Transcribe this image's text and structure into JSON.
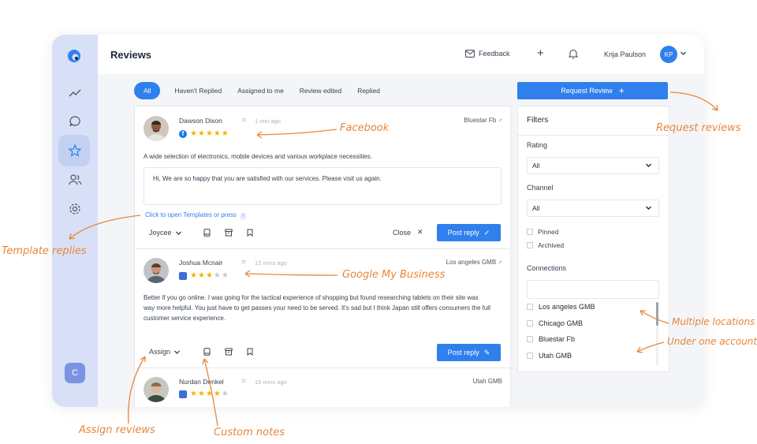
{
  "header": {
    "title": "Reviews",
    "feedback_label": "Feedback",
    "user_name": "Krija Paulson",
    "user_initials": "KP"
  },
  "sidebar": {
    "user_initial": "C",
    "items": [
      "analytics-icon",
      "chat-icon",
      "star-icon",
      "users-icon",
      "settings-icon"
    ]
  },
  "tabs": [
    {
      "label": "All",
      "active": true
    },
    {
      "label": "Haven't Replied"
    },
    {
      "label": "Assigned to me"
    },
    {
      "label": "Review edited"
    },
    {
      "label": "Replied"
    }
  ],
  "request_button": "Request Review",
  "reviews": [
    {
      "name": "Dawson Dixon",
      "time": "1 min ago",
      "channel": "Bluestar Fb",
      "source": "facebook",
      "rating": 5,
      "text": "A wide selection of electronics, mobile devices and various workplace necessities.",
      "reply": "Hi, We are so happy that you are satisfied with our services. Please visit us again.",
      "template_link": "Click to open Templates or press",
      "template_key": "/",
      "assignee": "Joycee",
      "close_label": "Close",
      "post_label": "Post reply"
    },
    {
      "name": "Joshua Mcnair",
      "time": "12 mins ago",
      "channel": "Los angeles GMB",
      "source": "google",
      "rating": 3,
      "text": "Better if you go online. I was going for the tactical experience of shopping but found researching tablets on their site was way more helpful. You just have to get passes your need to be served. It's sad but I think Japan still offers consumers the full customer service experience.",
      "assignee": "Assign",
      "post_label": "Post reply"
    },
    {
      "name": "Nurdan Denkel",
      "time": "15 mins ago",
      "channel": "Utah GMB",
      "source": "google",
      "rating": 4
    }
  ],
  "filters": {
    "title": "Filters",
    "rating_label": "Rating",
    "rating_value": "All",
    "channel_label": "Channel",
    "channel_value": "All",
    "checks": [
      "Pinned",
      "Archived"
    ],
    "connections_label": "Connections",
    "connections": [
      "Los angeles GMB",
      "Chicago GMB",
      "Bluestar Fb",
      "Utah GMB"
    ]
  },
  "annotations": {
    "facebook": "Facebook",
    "request_reviews": "Request reviews",
    "template_replies": "Template replies",
    "google_my_business": "Google My Business",
    "multiple_locations": "Multiple locations",
    "under_one_account": "Under one account",
    "assign_reviews": "Assign reviews",
    "custom_notes": "Custom notes"
  },
  "colors": {
    "accent": "#2f80ed",
    "sidebar": "#d7e0f7",
    "star": "#f5b301",
    "annotation": "#e8863a"
  }
}
